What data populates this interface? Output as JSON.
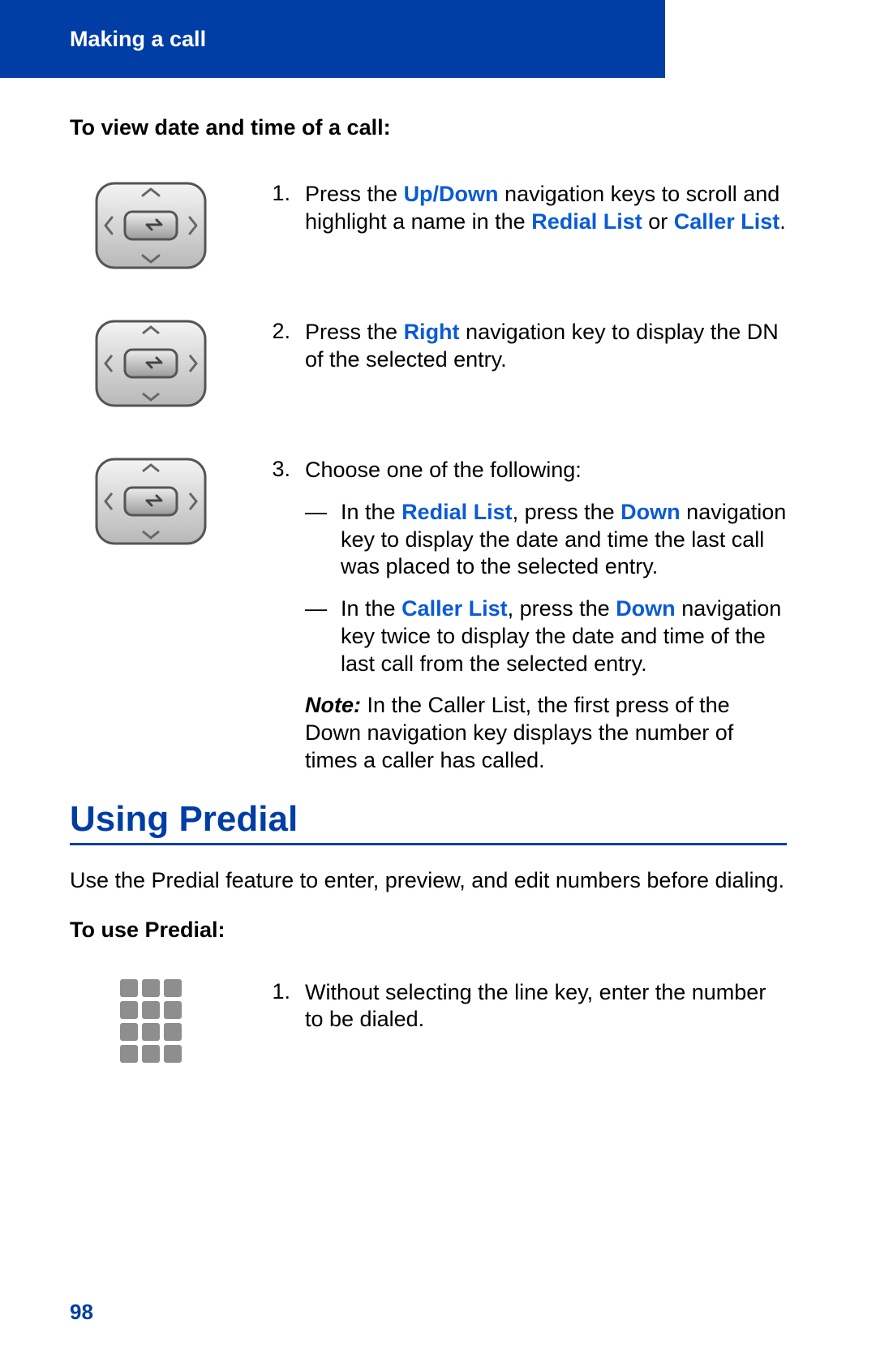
{
  "header": {
    "title": "Making a call"
  },
  "section1": {
    "heading": "To view date and time of a call:",
    "steps": [
      {
        "num": "1.",
        "parts": [
          {
            "t": "Press the "
          },
          {
            "t": "Up/Down",
            "hl": true
          },
          {
            "t": " navigation keys to scroll and highlight a name in the "
          },
          {
            "t": "Redial List",
            "hl": true
          },
          {
            "t": " or "
          },
          {
            "t": "Caller List",
            "hl": true
          },
          {
            "t": "."
          }
        ]
      },
      {
        "num": "2.",
        "parts": [
          {
            "t": "Press the "
          },
          {
            "t": "Right",
            "hl": true
          },
          {
            "t": " navigation key to display the DN of the selected entry."
          }
        ]
      },
      {
        "num": "3.",
        "intro": "Choose one of the following:",
        "bullets": [
          {
            "parts": [
              {
                "t": "In the "
              },
              {
                "t": "Redial List",
                "hl": true
              },
              {
                "t": ", press the "
              },
              {
                "t": "Down",
                "hl": true
              },
              {
                "t": " navigation key to display the date and time the last call was placed to the selected entry."
              }
            ]
          },
          {
            "parts": [
              {
                "t": "In the "
              },
              {
                "t": "Caller List",
                "hl": true
              },
              {
                "t": ", press the "
              },
              {
                "t": "Down",
                "hl": true
              },
              {
                "t": " navigation key twice to display the date and time of the last call from the selected entry."
              }
            ]
          }
        ],
        "note_label": "Note:",
        "note_text": " In the Caller List, the first press of the Down navigation key displays the number of times a caller has called."
      }
    ]
  },
  "section2": {
    "title": "Using Predial",
    "para": "Use the Predial feature to enter, preview, and edit numbers before dialing.",
    "heading": "To use Predial:",
    "step": {
      "num": "1.",
      "text": "Without selecting the line key, enter the number to be dialed."
    }
  },
  "footer": {
    "page": "98"
  }
}
